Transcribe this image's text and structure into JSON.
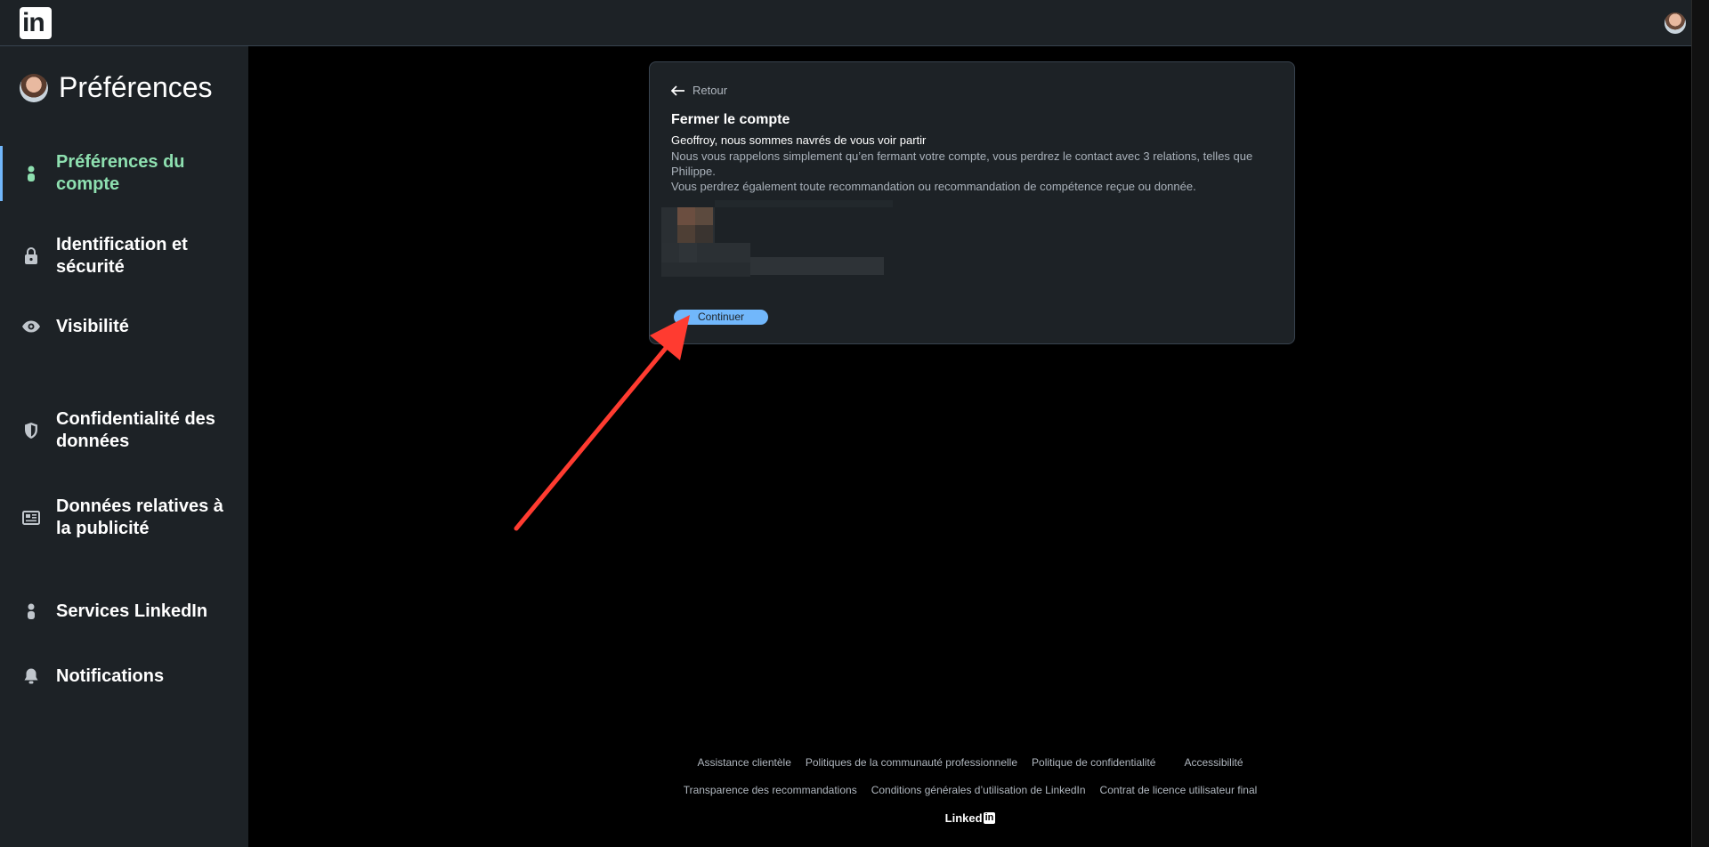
{
  "topbar": {
    "logo_text": "in",
    "avatar_icon": "user-avatar"
  },
  "sidebar": {
    "title": "Préférences",
    "items": [
      {
        "label": "Préférences du compte",
        "icon": "person-icon",
        "active": true
      },
      {
        "label": "Identification et sécurité",
        "icon": "lock-icon",
        "active": false
      },
      {
        "label": "Visibilité",
        "icon": "eye-icon",
        "active": false
      },
      {
        "label": "Confidentialité des données",
        "icon": "shield-icon",
        "active": false
      },
      {
        "label": "Données relatives à la publicité",
        "icon": "newspaper-icon",
        "active": false
      },
      {
        "label": "Services LinkedIn",
        "icon": "person-icon",
        "active": false
      },
      {
        "label": "Notifications",
        "icon": "bell-icon",
        "active": false
      }
    ]
  },
  "panel": {
    "back_label": "Retour",
    "title": "Fermer le compte",
    "subtitle": "Geoffroy, nous sommes navrés de vous voir partir",
    "line1": "Nous vous rappelons simplement qu’en fermant votre compte, vous perdrez le contact avec 3 relations, telles que Philippe.",
    "line2": "Vous perdrez également toute recommandation ou recommandation de compétence reçue ou donnée.",
    "continue_label": "Continuer"
  },
  "footer": {
    "row1": [
      "Assistance clientèle",
      "Politiques de la communauté professionnelle",
      "Politique de confidentialité",
      "Accessibilité"
    ],
    "row2": [
      "Transparence des recommandations",
      "Conditions générales d’utilisation de LinkedIn",
      "Contrat de licence utilisateur final"
    ],
    "brand": "Linked",
    "brand_in": "in"
  },
  "colors": {
    "accent": "#71b7fb",
    "active_nav": "#8ee0b0",
    "annotation_arrow": "#ff3b30"
  }
}
